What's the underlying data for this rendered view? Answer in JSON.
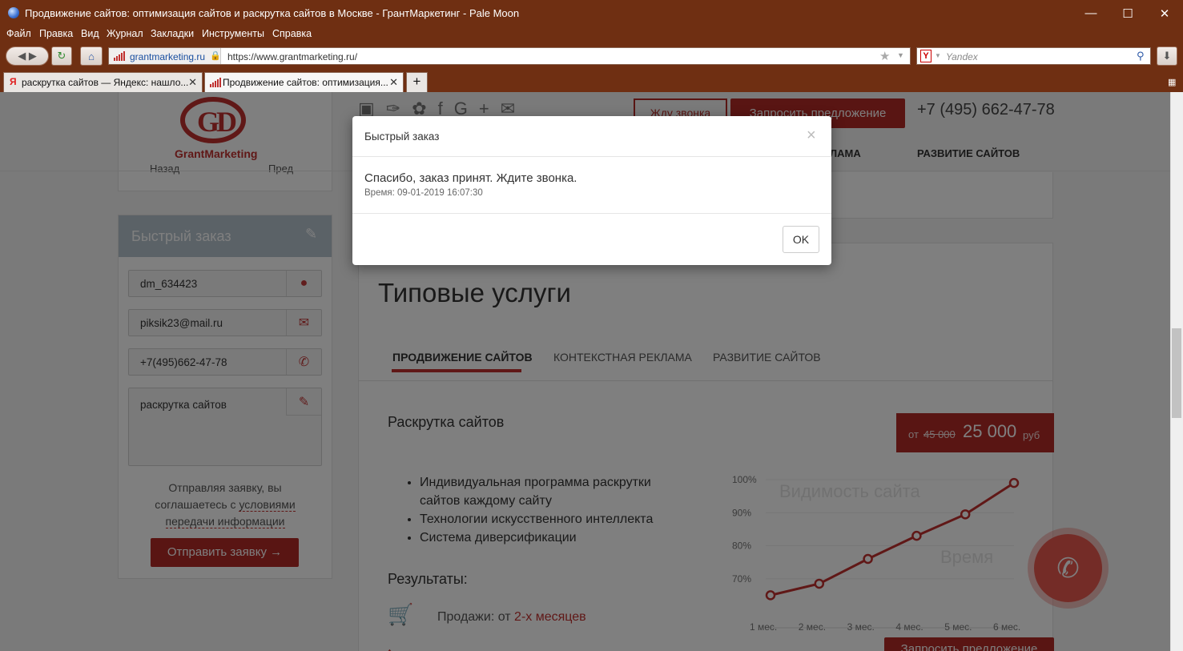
{
  "window": {
    "title": "Продвижение сайтов: оптимизация сайтов и раскрутка сайтов в Москве - ГрантМаркетинг - Pale Moon"
  },
  "menu": [
    "Файл",
    "Правка",
    "Вид",
    "Журнал",
    "Закладки",
    "Инструменты",
    "Справка"
  ],
  "nav": {
    "site_identity": "grantmarketing.ru",
    "url": "https://www.grantmarketing.ru/",
    "search_placeholder": "Yandex"
  },
  "tabs": [
    {
      "label": "раскрутка сайтов — Яндекс: нашло...",
      "active": false
    },
    {
      "label": "Продвижение сайтов: оптимизация...",
      "active": true
    }
  ],
  "header": {
    "logo_text": "GrantMarketing",
    "callback_button": "Жду звонка",
    "request_button": "Запросить предложение",
    "phone": "+7 (495) 662-47-78",
    "nav_items": [
      "ЛАМА",
      "РАЗВИТИЕ САЙТОВ"
    ],
    "behind_nav": [
      "Назад",
      "Пред"
    ]
  },
  "sidebar": {
    "title": "Быстрый заказ",
    "name_value": "dm_634423",
    "email_value": "piksik23@mail.ru",
    "phone_value": "+7(495)662-47-78",
    "message_value": "раскрутка сайтов",
    "consent_prefix": "Отправляя заявку, вы соглашаетесь с",
    "consent_link": "условиями передачи информации",
    "submit_label": "Отправить заявку"
  },
  "services": {
    "heading": "Типовые услуги",
    "tabs": [
      "ПРОДВИЖЕНИЕ САЙТОВ",
      "КОНТЕКСТНАЯ РЕКЛАМА",
      "РАЗВИТИЕ САЙТОВ"
    ],
    "active_tab": 0,
    "item_title": "Раскрутка сайтов",
    "price_prefix": "от",
    "old_price": "45 000",
    "new_price": "25 000",
    "currency": "руб",
    "bullets": [
      "Индивидуальная программа раскрутки сайтов каждому сайту",
      "Технологии искусственного интеллекта",
      "Система диверсификации"
    ],
    "results_label": "Результаты:",
    "sales_prefix": "Продажи: от",
    "sales_value": "2-х месяцев",
    "bottom_button": "Запросить предложение"
  },
  "chart_data": {
    "type": "line",
    "title": "Видимость сайта",
    "xlabel": "Время",
    "ylabel": "",
    "categories": [
      "1 мес.",
      "2 мес.",
      "3 мес.",
      "4 мес.",
      "5 мес.",
      "6 мес."
    ],
    "y_ticks": [
      "100%",
      "90%",
      "80%",
      "70%"
    ],
    "values": [
      65,
      68.5,
      76,
      83,
      89.5,
      99
    ],
    "ylim": [
      60,
      100
    ],
    "color": "#c0302f"
  },
  "modal": {
    "title": "Быстрый заказ",
    "close": "×",
    "message": "Спасибо, заказ принят. Ждите звонка.",
    "time_label": "Время:",
    "time_value": "09-01-2019 16:07:30",
    "ok_label": "OK"
  }
}
